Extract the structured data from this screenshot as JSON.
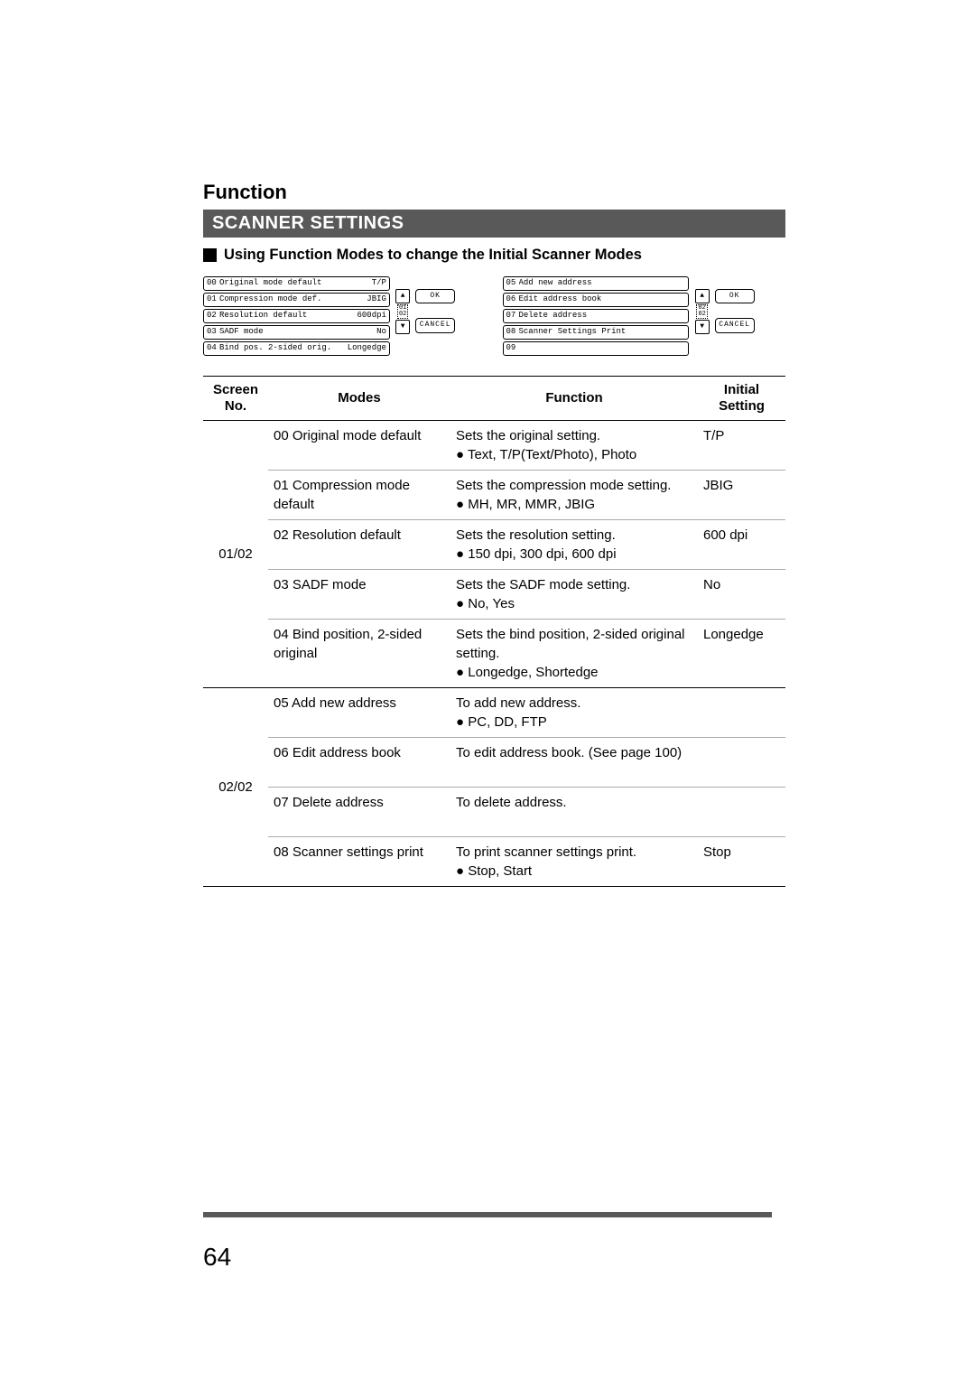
{
  "pageNumber": "64",
  "heading": "Function",
  "sectionTitle": "SCANNER SETTINGS",
  "subHeading": "Using Function Modes to change the Initial Scanner Modes",
  "screenshots": {
    "left": {
      "rows": [
        {
          "num": "00",
          "label": "Original mode default",
          "val": "T/P"
        },
        {
          "num": "01",
          "label": "Compression mode def.",
          "val": "JBIG"
        },
        {
          "num": "02",
          "label": "Resolution default",
          "val": "600dpi"
        },
        {
          "num": "03",
          "label": "SADF mode",
          "val": "No"
        },
        {
          "num": "04",
          "label": "Bind pos. 2-sided orig.",
          "val": "Longedge"
        }
      ],
      "page": "01\n02",
      "ok": "OK",
      "cancel": "CANCEL"
    },
    "right": {
      "rows": [
        {
          "num": "05",
          "label": "Add new address",
          "val": ""
        },
        {
          "num": "06",
          "label": "Edit address book",
          "val": ""
        },
        {
          "num": "07",
          "label": "Delete address",
          "val": ""
        },
        {
          "num": "08",
          "label": "Scanner Settings Print",
          "val": ""
        },
        {
          "num": "09",
          "label": "",
          "val": ""
        }
      ],
      "page": "02\n02",
      "ok": "OK",
      "cancel": "CANCEL"
    }
  },
  "table": {
    "headers": {
      "screen": "Screen\nNo.",
      "modes": "Modes",
      "function": "Function",
      "initial": "Initial\nSetting"
    },
    "group1": {
      "screen": "01/02",
      "rows": [
        {
          "mode": "00 Original mode default",
          "func1": "Sets the original setting.",
          "func2": "Text, T/P(Text/Photo), Photo",
          "init": "T/P"
        },
        {
          "mode": "01 Compression mode default",
          "func1": "Sets the compression mode setting.",
          "func2": "MH, MR, MMR, JBIG",
          "init": "JBIG"
        },
        {
          "mode": "02 Resolution default",
          "func1": "Sets the resolution setting.",
          "func2": "150 dpi, 300 dpi, 600 dpi",
          "init": "600 dpi"
        },
        {
          "mode": "03 SADF mode",
          "func1": "Sets the SADF mode setting.",
          "func2": "No, Yes",
          "init": "No"
        },
        {
          "mode": "04 Bind position, 2-sided original",
          "func1": "Sets the bind position, 2-sided original setting.",
          "func2": "Longedge, Shortedge",
          "init": "Longedge"
        }
      ]
    },
    "group2": {
      "screen": "02/02",
      "rows": [
        {
          "mode": "05 Add new address",
          "func1": "To add new address.",
          "func2": "PC, DD, FTP",
          "init": ""
        },
        {
          "mode": "06 Edit address book",
          "func1": "To edit address book. (See page 100)",
          "func2": "",
          "init": ""
        },
        {
          "mode": "07 Delete address",
          "func1": "To delete address.",
          "func2": "",
          "init": ""
        },
        {
          "mode": "08 Scanner settings print",
          "func1": "To print scanner settings print.",
          "func2": "Stop, Start",
          "init": "Stop"
        }
      ]
    }
  }
}
